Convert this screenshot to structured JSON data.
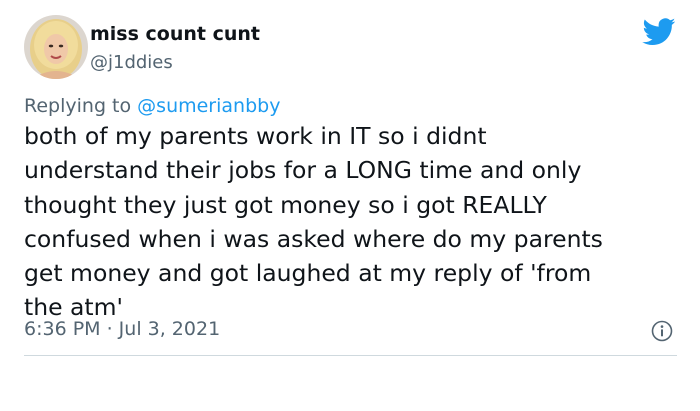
{
  "author": {
    "display_name": "miss count cunt",
    "handle": "@j1ddies",
    "avatar_icon": "user-avatar"
  },
  "reply": {
    "prefix": "Replying to",
    "handle": "@sumerianbby"
  },
  "tweet": {
    "text": "both of my parents work in IT so i didnt\nunderstand their jobs for a LONG time and only\nthought they just got money so i got REALLY\nconfused when i was asked where do my parents\nget money and got laughed at my reply of 'from\nthe atm'",
    "timestamp": "6:36 PM · Jul 3, 2021"
  },
  "icons": {
    "brand": "twitter-bird-icon",
    "info": "info-icon"
  },
  "colors": {
    "brand": "#1d9bf0",
    "secondary_text": "#536471",
    "primary_text": "#0f1419",
    "divider": "#cfd9de"
  }
}
